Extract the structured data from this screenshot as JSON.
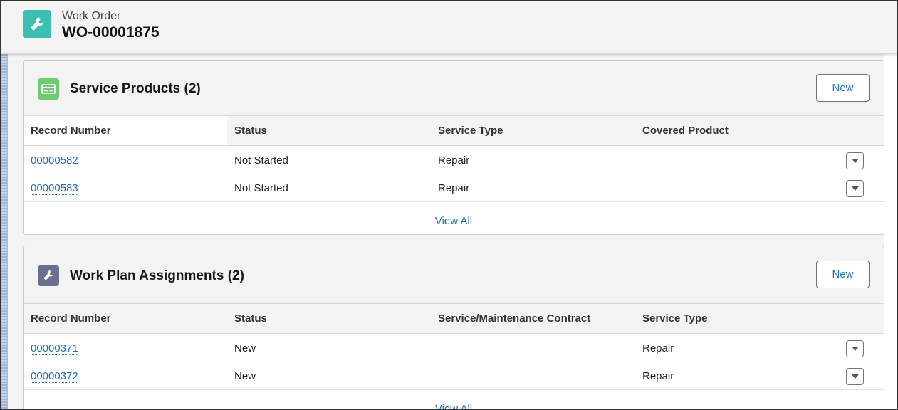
{
  "header": {
    "label": "Work Order",
    "title": "WO-00001875",
    "icon": "wrench-icon",
    "icon_color": "#3bbfb0"
  },
  "service_products": {
    "title": "Service Products (2)",
    "new_label": "New",
    "icon": "product-card-icon",
    "icon_color": "#6ccd6e",
    "columns": [
      "Record Number",
      "Status",
      "Service Type",
      "Covered Product"
    ],
    "rows": [
      {
        "record": "00000582",
        "status": "Not Started",
        "service_type": "Repair",
        "covered_product": ""
      },
      {
        "record": "00000583",
        "status": "Not Started",
        "service_type": "Repair",
        "covered_product": ""
      }
    ],
    "view_all": "View All"
  },
  "work_plan_assignments": {
    "title": "Work Plan Assignments (2)",
    "new_label": "New",
    "icon": "wrench-icon",
    "icon_color": "#6b6f8e",
    "columns": [
      "Record Number",
      "Status",
      "Service/Maintenance Contract",
      "Service Type"
    ],
    "rows": [
      {
        "record": "00000371",
        "status": "New",
        "contract": "",
        "service_type": "Repair"
      },
      {
        "record": "00000372",
        "status": "New",
        "contract": "",
        "service_type": "Repair"
      }
    ],
    "view_all": "View All"
  }
}
